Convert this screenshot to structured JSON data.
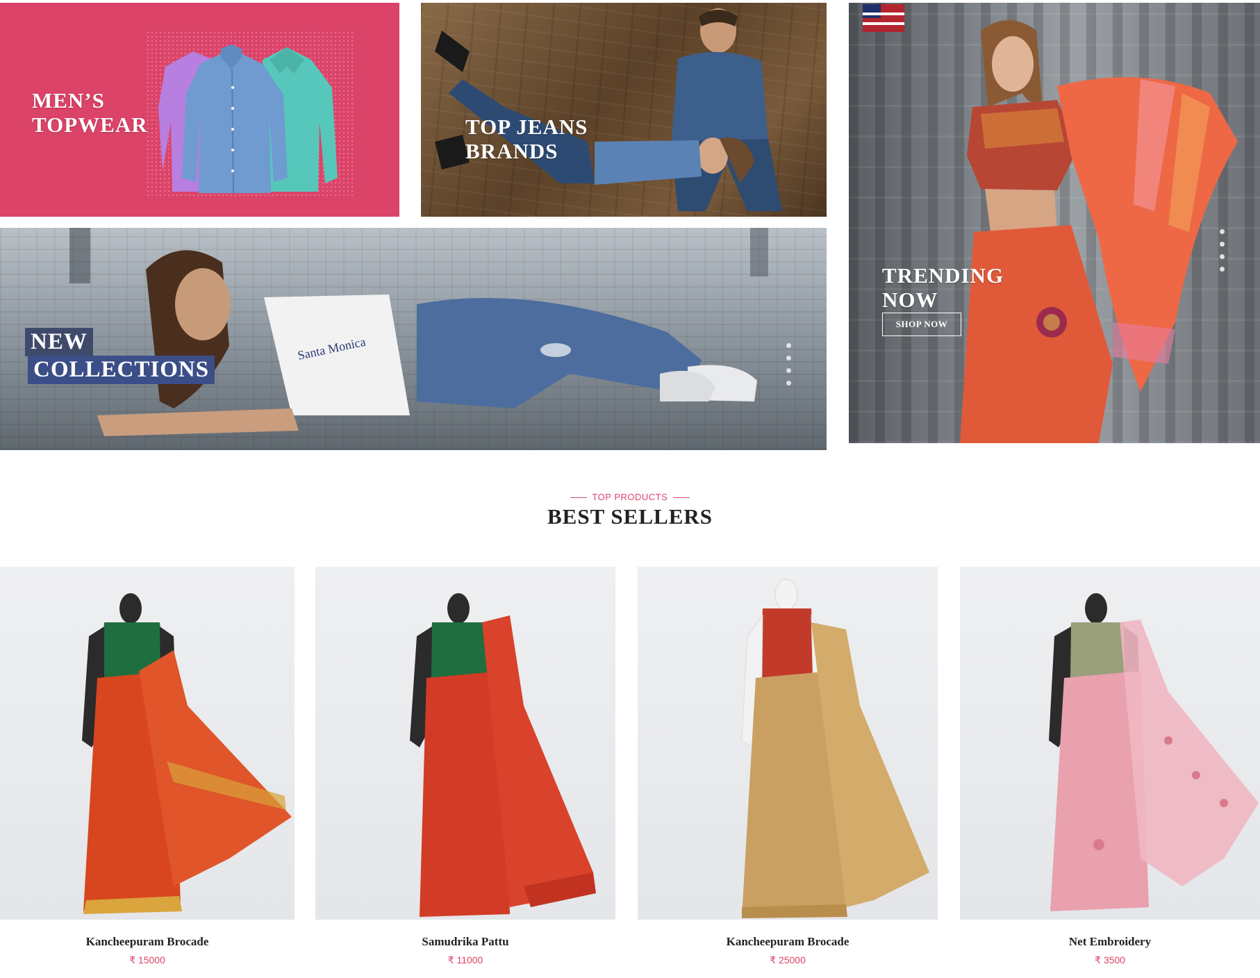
{
  "banners": {
    "mens": {
      "line1": "MEN’S",
      "line2": "TOPWEAR"
    },
    "jeans": {
      "line1": "TOP JEANS",
      "line2": "BRANDS"
    },
    "new": {
      "line1": "NEW",
      "line2": "COLLECTIONS"
    },
    "trending": {
      "line1": "TRENDING",
      "line2": "NOW",
      "button": "SHOP NOW"
    }
  },
  "section": {
    "eyebrow": "TOP PRODUCTS",
    "title": "BEST SELLERS"
  },
  "currency": "₹",
  "products": [
    {
      "name": "Kancheepuram Brocade",
      "price": "15000"
    },
    {
      "name": "Samudrika Pattu",
      "price": "11000"
    },
    {
      "name": "Kancheepuram Brocade",
      "price": "25000"
    },
    {
      "name": "Net Embroidery",
      "price": "3500"
    }
  ],
  "colors": {
    "accent": "#dc4368",
    "banner_pink": "#dc4368",
    "tag_navy": "#3b4e88"
  }
}
